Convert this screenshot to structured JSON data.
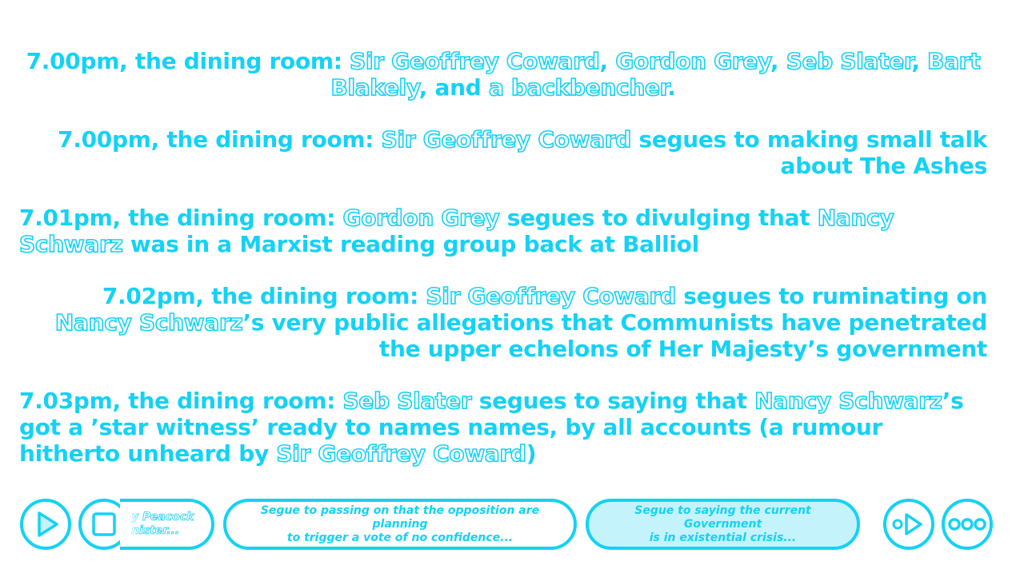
{
  "accent_color": "#14d2f5",
  "log": [
    {
      "align": "center",
      "parts": [
        {
          "t": "7.00pm, the dining room: ",
          "c": false
        },
        {
          "t": "Sir Geoffrey Coward",
          "c": true
        },
        {
          "t": ", ",
          "c": false
        },
        {
          "t": "Gordon Grey",
          "c": true
        },
        {
          "t": ", ",
          "c": false
        },
        {
          "t": "Seb Slater",
          "c": true
        },
        {
          "t": ", ",
          "c": false
        },
        {
          "t": "Bart Blakely",
          "c": true
        },
        {
          "t": ", and ",
          "c": false
        },
        {
          "t": "a backbencher",
          "c": true
        },
        {
          "t": ".",
          "c": false
        }
      ]
    },
    {
      "align": "right",
      "parts": [
        {
          "t": "7.00pm, the dining room: ",
          "c": false
        },
        {
          "t": "Sir Geoffrey Coward",
          "c": true
        },
        {
          "t": " segues to making small talk about The Ashes",
          "c": false
        }
      ]
    },
    {
      "align": "left",
      "parts": [
        {
          "t": "7.01pm, the dining room: ",
          "c": false
        },
        {
          "t": "Gordon Grey",
          "c": true
        },
        {
          "t": " segues to divulging that ",
          "c": false
        },
        {
          "t": "Nancy Schwarz",
          "c": true
        },
        {
          "t": " was in a Marxist reading group back at Balliol",
          "c": false
        }
      ]
    },
    {
      "align": "right",
      "parts": [
        {
          "t": "7.02pm, the dining room: ",
          "c": false
        },
        {
          "t": "Sir Geoffrey Coward",
          "c": true
        },
        {
          "t": " segues to ruminating on ",
          "c": false
        },
        {
          "t": "Nancy Schwarz",
          "c": true
        },
        {
          "t": "’s very public allegations that Communists have penetrated the upper echelons of Her Majesty’s government",
          "c": false
        }
      ]
    },
    {
      "align": "left",
      "parts": [
        {
          "t": "7.03pm, the dining room: ",
          "c": false
        },
        {
          "t": "Seb Slater",
          "c": true
        },
        {
          "t": " segues to saying that ",
          "c": false
        },
        {
          "t": "Nancy Schwarz",
          "c": true
        },
        {
          "t": "’s got a ’star witness’ ready to names names, by all accounts (a rumour hitherto unheard by ",
          "c": false
        },
        {
          "t": "Sir Geoffrey Coward",
          "c": true
        },
        {
          "t": ")",
          "c": false
        }
      ]
    }
  ],
  "controls": {
    "play_icon": "play-icon",
    "stop_icon": "stop-icon",
    "fast_forward_icon": "fast-forward-icon",
    "more_icon": "more-icon"
  },
  "options": {
    "partial_line1": "y Peacock",
    "partial_line2": "nister...",
    "mid_line1": "Segue to passing on that the opposition are planning",
    "mid_line2": "to trigger a vote of no confidence...",
    "active_line1": "Segue to saying the current Government",
    "active_line2": "is in existential crisis..."
  }
}
